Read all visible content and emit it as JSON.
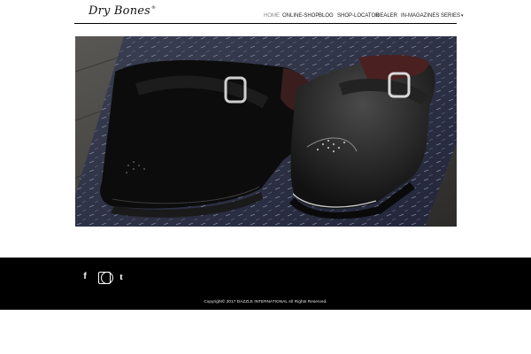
{
  "brand": {
    "logo_text": "Dry Bones",
    "logo_mark": "®"
  },
  "nav": {
    "items": [
      {
        "label": "HOME",
        "active": true
      },
      {
        "label": "ONLINE-SHOP"
      },
      {
        "label": "BLOG"
      },
      {
        "label": "SHOP-LOCATOR"
      },
      {
        "label": "DEALER"
      },
      {
        "label": "IN-MAGAZINES"
      },
      {
        "label": "SERIES",
        "has_dropdown": true
      }
    ],
    "dropdown_caret": "▾"
  },
  "hero": {
    "image_subject": "black suede and black leather creeper shoes with buckle straps on denim"
  },
  "footer": {
    "social": [
      {
        "icon": "facebook-icon",
        "glyph": "f"
      },
      {
        "icon": "instagram-icon"
      },
      {
        "icon": "tumblr-icon",
        "glyph": "t"
      }
    ],
    "copyright": "Copyright© 2017 DAZZLE INTERNATIONAL All Rights Reserved."
  },
  "colors": {
    "footer_bg": "#000000",
    "nav_active": "#888888",
    "text": "#222222"
  }
}
